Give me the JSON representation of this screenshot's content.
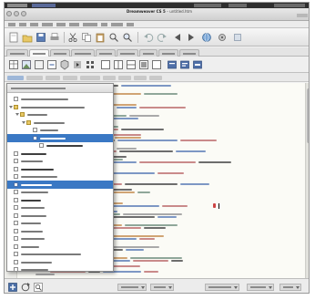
{
  "window": {
    "title_bold": "Dreamweaver CS 5",
    "title_path": "untitled.htm"
  },
  "menu": {
    "items": [
      "File",
      "Edit",
      "View",
      "Insert",
      "Modify",
      "Format",
      "Commands",
      "Site",
      "Window",
      "Help"
    ]
  },
  "icons": {
    "toolbar": [
      "new-document-icon",
      "open-folder-icon",
      "save-icon",
      "print-icon",
      "cut-icon",
      "copy-icon",
      "paste-icon",
      "find-icon",
      "zoom-icon",
      "undo-icon",
      "redo-icon",
      "back-icon",
      "forward-icon",
      "browse-icon",
      "settings-icon"
    ],
    "tools2": [
      "insert-table-icon",
      "insert-image-icon",
      "insert-div-icon",
      "insert-link-icon",
      "insert-form-icon",
      "media-icon",
      "grid-icon",
      "code-view-icon",
      "split-view-icon",
      "design-view-icon",
      "live-view-icon",
      "preview-icon",
      "validate-icon",
      "check-icon",
      "refresh-icon"
    ],
    "bottom": [
      "add-icon",
      "refresh-icon",
      "search-icon"
    ]
  },
  "colors": {
    "selection": "#3a78c4",
    "folder": "#e8c866",
    "code_tag": "#7d97c4",
    "code_attr": "#c98a8a",
    "code_comment": "#8fa79a"
  }
}
